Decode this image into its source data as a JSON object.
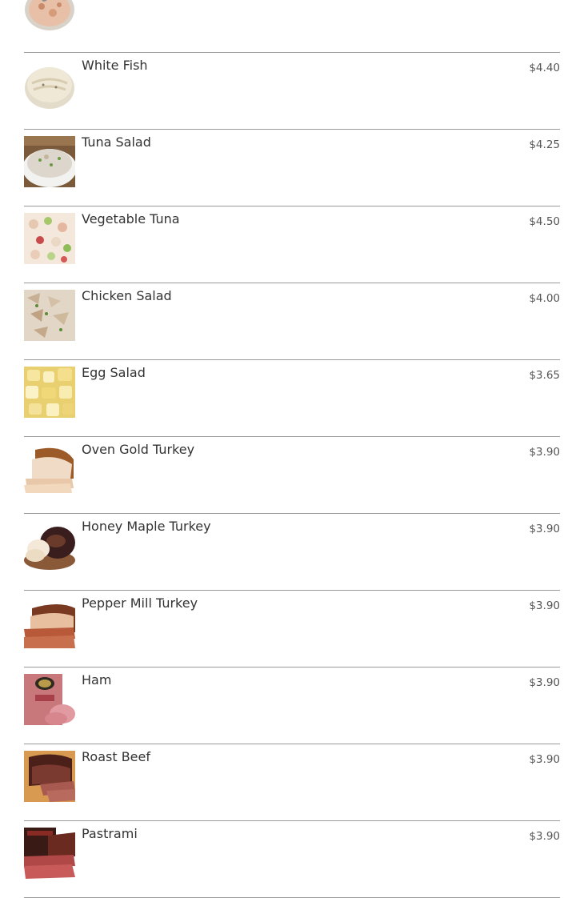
{
  "menu": {
    "items": [
      {
        "name": "White Fish",
        "price": "$4.40",
        "image_icon": "white-fish-photo"
      },
      {
        "name": "Tuna Salad",
        "price": "$4.25",
        "image_icon": "tuna-salad-photo"
      },
      {
        "name": "Vegetable Tuna",
        "price": "$4.50",
        "image_icon": "vegetable-tuna-photo"
      },
      {
        "name": "Chicken Salad",
        "price": "$4.00",
        "image_icon": "chicken-salad-photo"
      },
      {
        "name": "Egg Salad",
        "price": "$3.65",
        "image_icon": "egg-salad-photo"
      },
      {
        "name": "Oven Gold Turkey",
        "price": "$3.90",
        "image_icon": "oven-gold-turkey-photo"
      },
      {
        "name": "Honey Maple Turkey",
        "price": "$3.90",
        "image_icon": "honey-maple-turkey-photo"
      },
      {
        "name": "Pepper Mill Turkey",
        "price": "$3.90",
        "image_icon": "pepper-mill-turkey-photo"
      },
      {
        "name": "Ham",
        "price": "$3.90",
        "image_icon": "ham-photo"
      },
      {
        "name": "Roast Beef",
        "price": "$3.90",
        "image_icon": "roast-beef-photo"
      },
      {
        "name": "Pastrami",
        "price": "$3.90",
        "image_icon": "pastrami-photo"
      }
    ]
  },
  "colors": {
    "divider": "#9a9a9a",
    "text": "#333333",
    "price_text": "#555555"
  }
}
